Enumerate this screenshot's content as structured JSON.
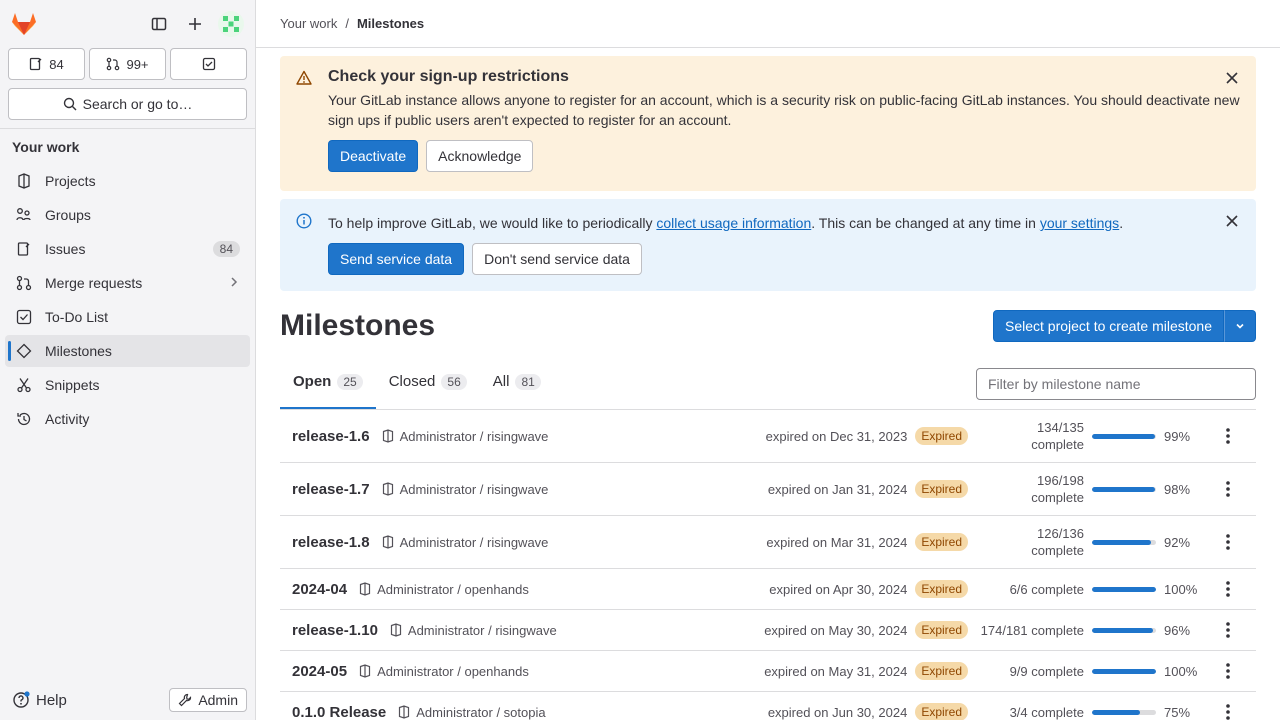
{
  "sidebar": {
    "counts": {
      "issues": "84",
      "merge_requests": "99+"
    },
    "search_label": "Search or go to…",
    "section_title": "Your work",
    "items": [
      {
        "label": "Projects"
      },
      {
        "label": "Groups"
      },
      {
        "label": "Issues",
        "badge": "84"
      },
      {
        "label": "Merge requests"
      },
      {
        "label": "To-Do List"
      },
      {
        "label": "Milestones"
      },
      {
        "label": "Snippets"
      },
      {
        "label": "Activity"
      }
    ],
    "help_label": "Help",
    "admin_label": "Admin"
  },
  "breadcrumb": {
    "parent": "Your work",
    "separator": "/",
    "current": "Milestones"
  },
  "alerts": {
    "signup": {
      "title": "Check your sign-up restrictions",
      "body": "Your GitLab instance allows anyone to register for an account, which is a security risk on public-facing GitLab instances. You should deactivate new sign ups if public users aren't expected to register for an account.",
      "primary": "Deactivate",
      "secondary": "Acknowledge"
    },
    "usage": {
      "text_before": "To help improve GitLab, we would like to periodically ",
      "link1": "collect usage information",
      "text_middle": ". This can be changed at any time in ",
      "link2": "your settings",
      "text_after": ".",
      "primary": "Send service data",
      "secondary": "Don't send service data"
    }
  },
  "page": {
    "title": "Milestones",
    "create_button": "Select project to create milestone"
  },
  "tabs": [
    {
      "label": "Open",
      "count": "25"
    },
    {
      "label": "Closed",
      "count": "56"
    },
    {
      "label": "All",
      "count": "81"
    }
  ],
  "filter_placeholder": "Filter by milestone name",
  "milestones": [
    {
      "name": "release-1.6",
      "project": "Administrator / risingwave",
      "expired": "expired on Dec 31, 2023",
      "badge": "Expired",
      "complete_line1": "134/135",
      "complete_line2": "complete",
      "percent": "99%",
      "progress": 0.99
    },
    {
      "name": "release-1.7",
      "project": "Administrator / risingwave",
      "expired": "expired on Jan 31, 2024",
      "badge": "Expired",
      "complete_line1": "196/198",
      "complete_line2": "complete",
      "percent": "98%",
      "progress": 0.98
    },
    {
      "name": "release-1.8",
      "project": "Administrator / risingwave",
      "expired": "expired on Mar 31, 2024",
      "badge": "Expired",
      "complete_line1": "126/136",
      "complete_line2": "complete",
      "percent": "92%",
      "progress": 0.92
    },
    {
      "name": "2024-04",
      "project": "Administrator / openhands",
      "expired": "expired on Apr 30, 2024",
      "badge": "Expired",
      "complete_line1": "6/6 complete",
      "complete_line2": "",
      "percent": "100%",
      "progress": 1.0
    },
    {
      "name": "release-1.10",
      "project": "Administrator / risingwave",
      "expired": "expired on May 30, 2024",
      "badge": "Expired",
      "complete_line1": "174/181 complete",
      "complete_line2": "",
      "percent": "96%",
      "progress": 0.96
    },
    {
      "name": "2024-05",
      "project": "Administrator / openhands",
      "expired": "expired on May 31, 2024",
      "badge": "Expired",
      "complete_line1": "9/9 complete",
      "complete_line2": "",
      "percent": "100%",
      "progress": 1.0
    },
    {
      "name": "0.1.0 Release",
      "project": "Administrator / sotopia",
      "expired": "expired on Jun 30, 2024",
      "badge": "Expired",
      "complete_line1": "3/4 complete",
      "complete_line2": "",
      "percent": "75%",
      "progress": 0.75
    }
  ],
  "colors": {
    "accent": "#1f75cb",
    "warning_bg": "#fdf1dd",
    "info_bg": "#e9f3fc",
    "expired_badge": "#f5d9a8"
  }
}
